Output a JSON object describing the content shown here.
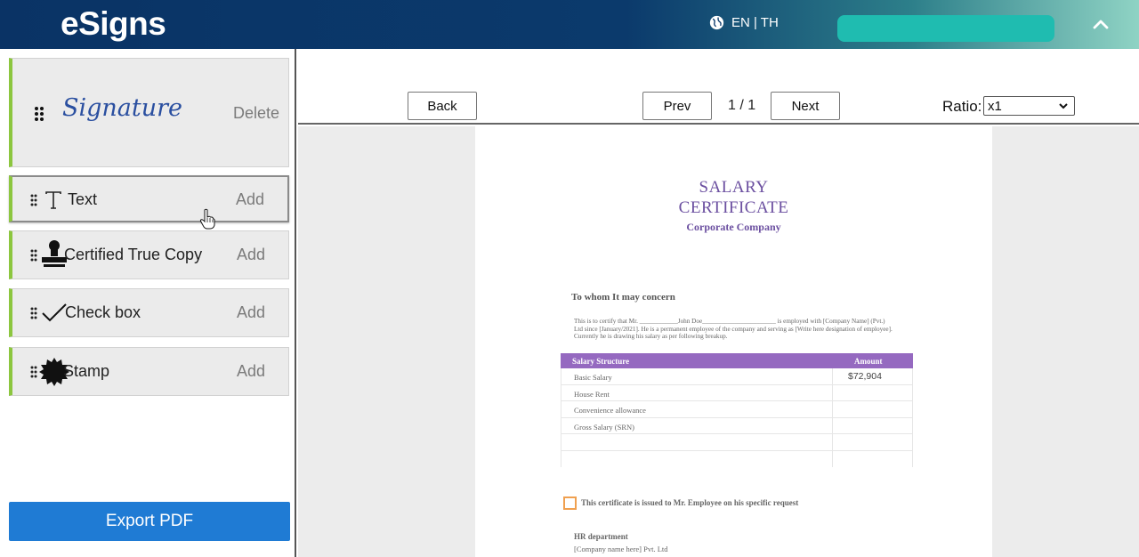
{
  "header": {
    "logo": "eSigns",
    "language": "EN | TH"
  },
  "sidebar": {
    "signature": {
      "text": "Signature",
      "action": "Delete"
    },
    "tools": [
      {
        "label": "Text",
        "action": "Add",
        "icon": "text-icon"
      },
      {
        "label": "Certified True Copy",
        "action": "Add",
        "icon": "stamp-icon"
      },
      {
        "label": "Check box",
        "action": "Add",
        "icon": "checkmark-icon"
      },
      {
        "label": "Stamp",
        "action": "Add",
        "icon": "seal-icon"
      }
    ],
    "export_label": "Export PDF"
  },
  "toolbar": {
    "back_label": "Back",
    "prev_label": "Prev",
    "page_count": "1 / 1",
    "next_label": "Next",
    "ratio_label": "Ratio:",
    "ratio_value": "x1"
  },
  "document": {
    "title_line1": "SALARY",
    "title_line2": "CERTIFICATE",
    "company": "Corporate Company",
    "greeting": "To whom It may concern",
    "paragraph": "This is to certify that Mr. ____________John  Doe_______________________  is employed with [Company Name] (Pvt.) Ltd since [January/2021]. He is a permanent employee of the company and serving  as [Write  here designation of employee]. Currently he is drawing his salary as per following breakup.",
    "table": {
      "headers": [
        "Salary  Structure",
        "Amount"
      ],
      "rows": [
        [
          "Basic Salary",
          "$72,904"
        ],
        [
          "House Rent",
          ""
        ],
        [
          "Convenience allowance",
          ""
        ],
        [
          "Gross Salary  (SRN)",
          ""
        ],
        [
          "",
          ""
        ],
        [
          "",
          ""
        ]
      ]
    },
    "certificate_note": "This certificate is issued to Mr. Employee on his specific request",
    "hr_department": "HR department",
    "hr_company": "[Company name here] Pvt. Ltd"
  },
  "colors": {
    "header_dark": "#0a3365",
    "accent_green": "#8cc63f",
    "export_blue": "#1f7bd4",
    "title_purple": "#6b4fa0",
    "table_header": "#9569c0",
    "user_pill": "#1fbcb0"
  }
}
